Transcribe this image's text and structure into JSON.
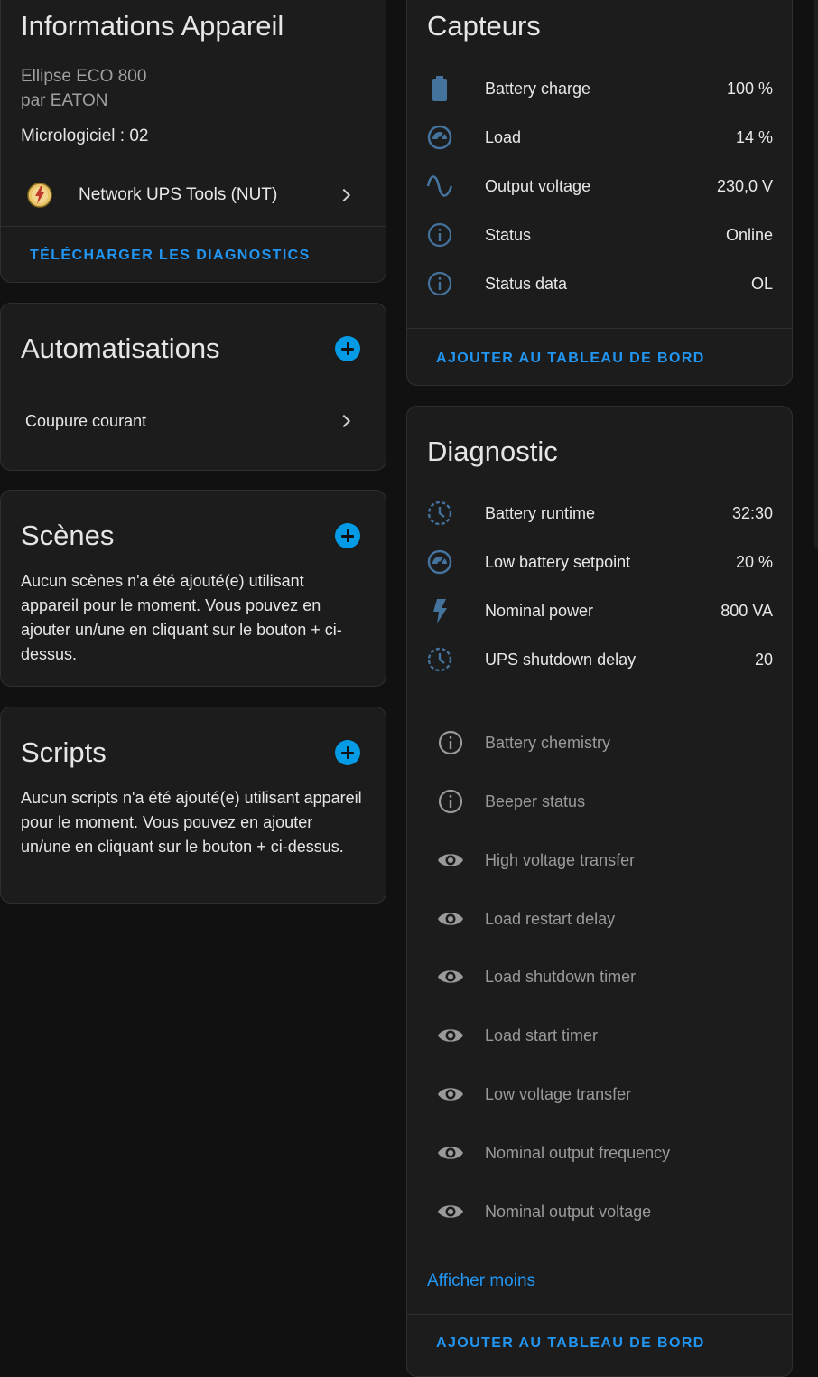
{
  "device_info": {
    "title": "Informations Appareil",
    "model": "Ellipse ECO 800",
    "manufacturer": "par EATON",
    "firmware": "Micrologiciel : 02",
    "integration": {
      "label": "Network UPS Tools (NUT)",
      "icon": "nut-logo-icon"
    },
    "download_label": "TÉLÉCHARGER LES DIAGNOSTICS"
  },
  "automations": {
    "title": "Automatisations",
    "items": [
      {
        "label": "Coupure courant"
      }
    ]
  },
  "scenes": {
    "title": "Scènes",
    "empty_text": "Aucun scènes n'a été ajouté(e) utilisant appareil pour le moment. Vous pouvez en ajouter un/une en cliquant sur le bouton + ci-dessus."
  },
  "scripts": {
    "title": "Scripts",
    "empty_text": "Aucun scripts n'a été ajouté(e) utilisant appareil pour le moment. Vous pouvez en ajouter un/une en cliquant sur le bouton + ci-dessus."
  },
  "sensors": {
    "title": "Capteurs",
    "items": [
      {
        "label": "Battery charge",
        "value": "100 %",
        "icon": "battery-icon"
      },
      {
        "label": "Load",
        "value": "14 %",
        "icon": "gauge-icon"
      },
      {
        "label": "Output voltage",
        "value": "230,0 V",
        "icon": "sine-wave-icon"
      },
      {
        "label": "Status",
        "value": "Online",
        "icon": "info-icon"
      },
      {
        "label": "Status data",
        "value": "OL",
        "icon": "info-icon"
      }
    ],
    "add_label": "AJOUTER AU TABLEAU DE BORD"
  },
  "diagnostic": {
    "title": "Diagnostic",
    "items": [
      {
        "label": "Battery runtime",
        "value": "32:30",
        "icon": "timer-icon"
      },
      {
        "label": "Low battery setpoint",
        "value": "20 %",
        "icon": "gauge-icon"
      },
      {
        "label": "Nominal power",
        "value": "800 VA",
        "icon": "flash-icon"
      },
      {
        "label": "UPS shutdown delay",
        "value": "20",
        "icon": "timer-icon"
      }
    ],
    "disabled_items": [
      {
        "label": "Battery chemistry",
        "icon": "info-icon"
      },
      {
        "label": "Beeper status",
        "icon": "info-icon"
      },
      {
        "label": "High voltage transfer",
        "icon": "eye-icon"
      },
      {
        "label": "Load restart delay",
        "icon": "eye-icon"
      },
      {
        "label": "Load shutdown timer",
        "icon": "eye-icon"
      },
      {
        "label": "Load start timer",
        "icon": "eye-icon"
      },
      {
        "label": "Low voltage transfer",
        "icon": "eye-icon"
      },
      {
        "label": "Nominal output frequency",
        "icon": "eye-icon"
      },
      {
        "label": "Nominal output voltage",
        "icon": "eye-icon"
      }
    ],
    "show_less_label": "Afficher moins",
    "add_label": "AJOUTER AU TABLEAU DE BORD"
  },
  "colors": {
    "accent": "#2196f3",
    "icon_active": "#44739e",
    "icon_disabled": "#9a9a9a",
    "card_bg": "#1c1c1c",
    "page_bg": "#111111"
  }
}
